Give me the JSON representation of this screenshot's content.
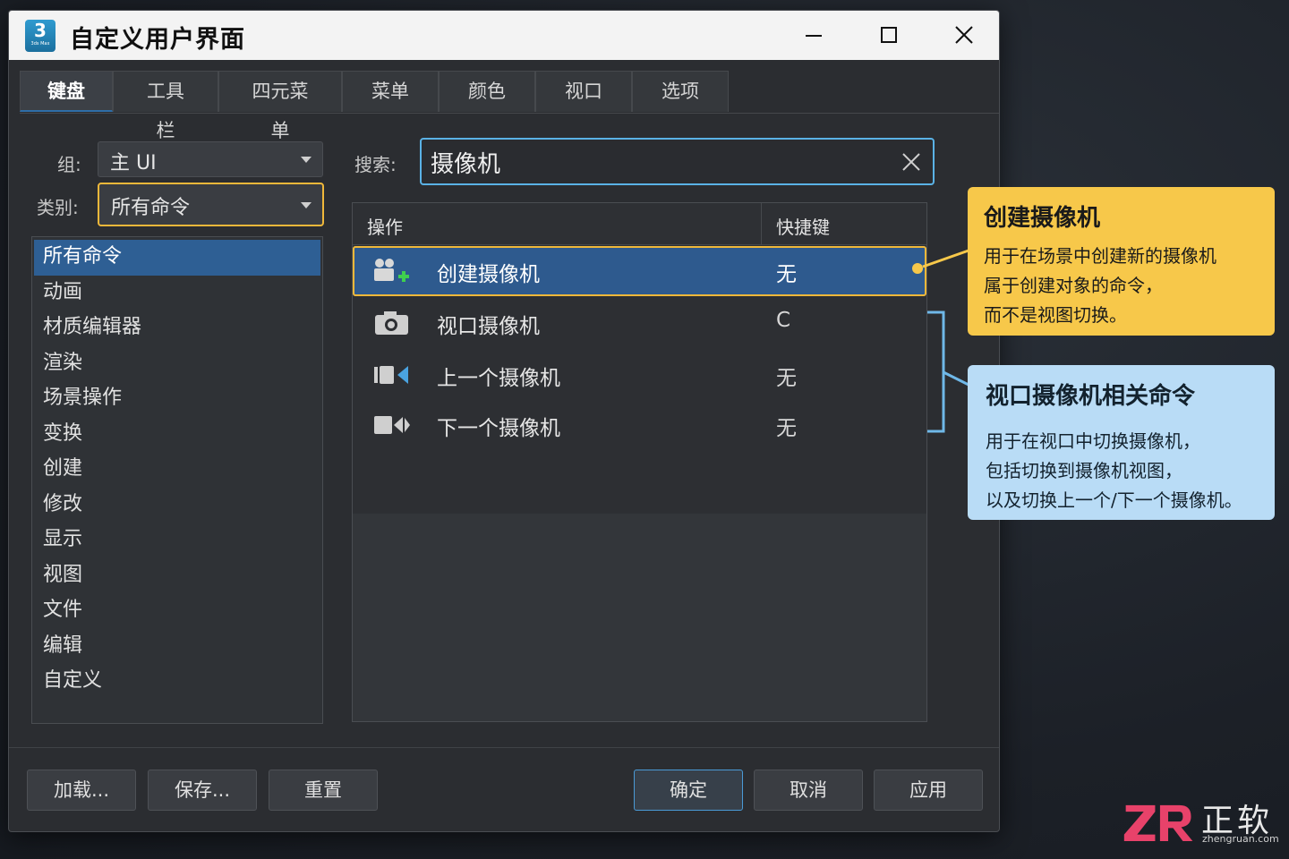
{
  "window": {
    "title": "自定义用户界面",
    "app_icon_num": "3",
    "app_icon_sub": "3ds Max"
  },
  "tabs": [
    "键盘",
    "工具栏",
    "四元菜单",
    "菜单",
    "颜色",
    "视口",
    "选项"
  ],
  "left": {
    "group_label": "组:",
    "group_value": "主 UI",
    "category_label": "类别:",
    "category_value": "所有命令",
    "categories": [
      "所有命令",
      "动画",
      "材质编辑器",
      "渲染",
      "场景操作",
      "变换",
      "创建",
      "修改",
      "显示",
      "视图",
      "文件",
      "编辑",
      "自定义"
    ]
  },
  "search": {
    "label": "搜索:",
    "value": "摄像机"
  },
  "table": {
    "col_action": "操作",
    "col_shortcut": "快捷键",
    "rows": [
      {
        "name": "创建摄像机",
        "key": "无",
        "icon": "create-camera-icon"
      },
      {
        "name": "视口摄像机",
        "key": "C",
        "icon": "camera-icon"
      },
      {
        "name": "上一个摄像机",
        "key": "无",
        "icon": "previous-camera-icon"
      },
      {
        "name": "下一个摄像机",
        "key": "无",
        "icon": "next-camera-icon"
      }
    ]
  },
  "footer": {
    "load": "加载...",
    "save": "保存...",
    "reset": "重置",
    "ok": "确定",
    "cancel": "取消",
    "apply": "应用"
  },
  "callouts": {
    "yellow": {
      "title": "创建摄像机",
      "lines": [
        "用于在场景中创建新的摄像机",
        "属于创建对象的命令，",
        "而不是视图切换。"
      ]
    },
    "blue": {
      "title": "视口摄像机相关命令",
      "lines": [
        "用于在视口中切换摄像机，",
        "包括切换到摄像机视图，",
        "以及切换上一个/下一个摄像机。"
      ]
    }
  },
  "watermark": {
    "cn": "正软",
    "url": "zhengruan.com"
  },
  "colors": {
    "accent_yellow": "#f7c84a",
    "accent_blue": "#b9dcf6",
    "selection": "#2e5a8e",
    "highlight_border": "#f0b83a"
  }
}
